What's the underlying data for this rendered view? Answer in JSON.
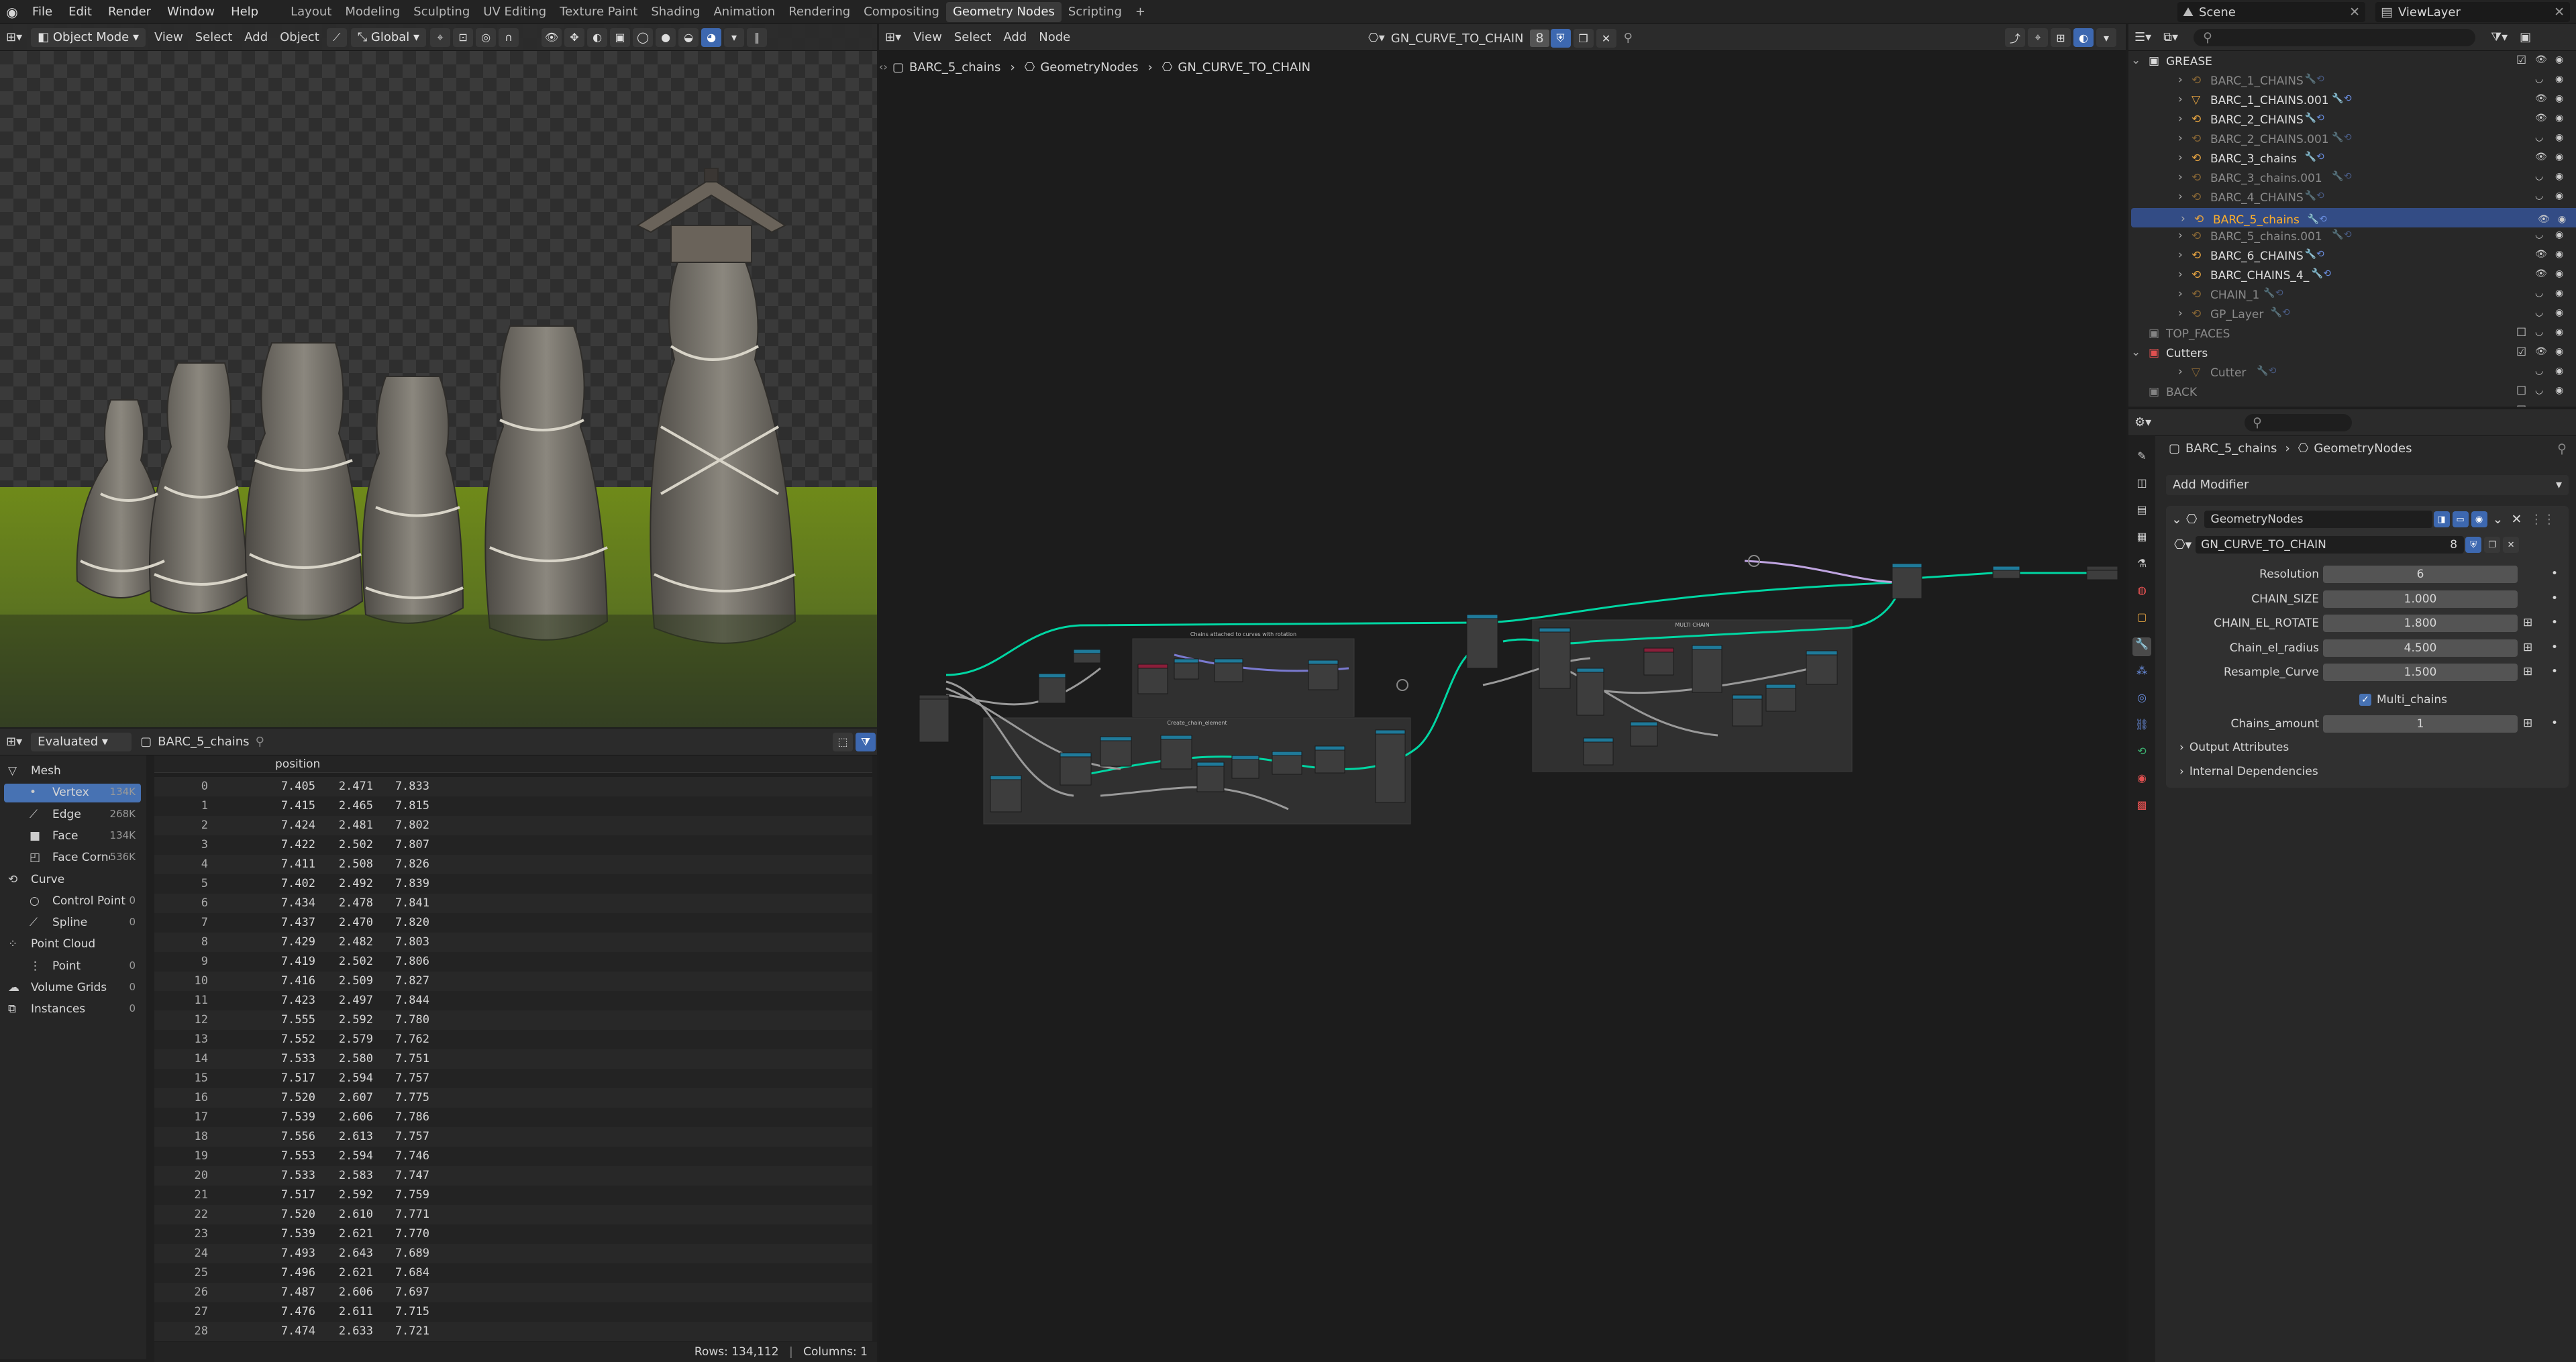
{
  "topbar": {
    "menus": [
      "File",
      "Edit",
      "Render",
      "Window",
      "Help"
    ],
    "workspaces": [
      "Layout",
      "Modeling",
      "Sculpting",
      "UV Editing",
      "Texture Paint",
      "Shading",
      "Animation",
      "Rendering",
      "Compositing",
      "Geometry Nodes",
      "Scripting"
    ],
    "active_workspace": "Geometry Nodes",
    "add_tab": "+",
    "scene": "Scene",
    "view_layer": "ViewLayer"
  },
  "viewport": {
    "mode": "Object Mode",
    "menus": [
      "View",
      "Select",
      "Add",
      "Object"
    ],
    "orientation": "Global"
  },
  "spreadsheet": {
    "display": "Evaluated",
    "object": "BARC_5_chains",
    "column_header": "position",
    "tree": [
      {
        "label": "Mesh",
        "count": "",
        "indent": 0,
        "icon": "mesh-icon"
      },
      {
        "label": "Vertex",
        "count": "134K",
        "indent": 1,
        "icon": "vertex-icon",
        "active": true
      },
      {
        "label": "Edge",
        "count": "268K",
        "indent": 1,
        "icon": "edge-icon"
      },
      {
        "label": "Face",
        "count": "134K",
        "indent": 1,
        "icon": "face-icon"
      },
      {
        "label": "Face Corner",
        "count": "536K",
        "indent": 1,
        "icon": "face-corner-icon"
      },
      {
        "label": "Curve",
        "count": "",
        "indent": 0,
        "icon": "curve-icon"
      },
      {
        "label": "Control Point",
        "count": "0",
        "indent": 1,
        "icon": "control-point-icon"
      },
      {
        "label": "Spline",
        "count": "0",
        "indent": 1,
        "icon": "spline-icon"
      },
      {
        "label": "Point Cloud",
        "count": "",
        "indent": 0,
        "icon": "point-cloud-icon"
      },
      {
        "label": "Point",
        "count": "0",
        "indent": 1,
        "icon": "point-icon"
      },
      {
        "label": "Volume Grids",
        "count": "0",
        "indent": 0,
        "icon": "volume-icon"
      },
      {
        "label": "Instances",
        "count": "0",
        "indent": 0,
        "icon": "instances-icon"
      }
    ],
    "rows": [
      [
        "0",
        "7.405",
        "2.471",
        "7.833"
      ],
      [
        "1",
        "7.415",
        "2.465",
        "7.815"
      ],
      [
        "2",
        "7.424",
        "2.481",
        "7.802"
      ],
      [
        "3",
        "7.422",
        "2.502",
        "7.807"
      ],
      [
        "4",
        "7.411",
        "2.508",
        "7.826"
      ],
      [
        "5",
        "7.402",
        "2.492",
        "7.839"
      ],
      [
        "6",
        "7.434",
        "2.478",
        "7.841"
      ],
      [
        "7",
        "7.437",
        "2.470",
        "7.820"
      ],
      [
        "8",
        "7.429",
        "2.482",
        "7.803"
      ],
      [
        "9",
        "7.419",
        "2.502",
        "7.806"
      ],
      [
        "10",
        "7.416",
        "2.509",
        "7.827"
      ],
      [
        "11",
        "7.423",
        "2.497",
        "7.844"
      ],
      [
        "12",
        "7.555",
        "2.592",
        "7.780"
      ],
      [
        "13",
        "7.552",
        "2.579",
        "7.762"
      ],
      [
        "14",
        "7.533",
        "2.580",
        "7.751"
      ],
      [
        "15",
        "7.517",
        "2.594",
        "7.757"
      ],
      [
        "16",
        "7.520",
        "2.607",
        "7.775"
      ],
      [
        "17",
        "7.539",
        "2.606",
        "7.786"
      ],
      [
        "18",
        "7.556",
        "2.613",
        "7.757"
      ],
      [
        "19",
        "7.553",
        "2.594",
        "7.746"
      ],
      [
        "20",
        "7.533",
        "2.583",
        "7.747"
      ],
      [
        "21",
        "7.517",
        "2.592",
        "7.759"
      ],
      [
        "22",
        "7.520",
        "2.610",
        "7.771"
      ],
      [
        "23",
        "7.539",
        "2.621",
        "7.770"
      ],
      [
        "24",
        "7.493",
        "2.643",
        "7.689"
      ],
      [
        "25",
        "7.496",
        "2.621",
        "7.684"
      ],
      [
        "26",
        "7.487",
        "2.606",
        "7.697"
      ],
      [
        "27",
        "7.476",
        "2.611",
        "7.715"
      ],
      [
        "28",
        "7.474",
        "2.633",
        "7.721"
      ]
    ],
    "footer_rows": "Rows: 134,112",
    "footer_sep": "|",
    "footer_cols": "Columns: 1"
  },
  "node_editor": {
    "menus": [
      "View",
      "Select",
      "Add",
      "Node"
    ],
    "tree_name": "GN_CURVE_TO_CHAIN",
    "users": "8",
    "breadcrumb": [
      "BARC_5_chains",
      "GeometryNodes",
      "GN_CURVE_TO_CHAIN"
    ],
    "frame_labels": [
      "Chains attached to curves with rotation",
      "Create_chain_element",
      "MULTI CHAIN"
    ]
  },
  "outliner": {
    "items": [
      {
        "label": "GREASE",
        "level": 0,
        "type": "collection",
        "dim": false
      },
      {
        "label": "BARC_1_CHAINS",
        "level": 1,
        "type": "gp",
        "dim": true
      },
      {
        "label": "BARC_1_CHAINS.001",
        "level": 1,
        "type": "mesh",
        "dim": false
      },
      {
        "label": "BARC_2_CHAINS",
        "level": 1,
        "type": "gp",
        "dim": false
      },
      {
        "label": "BARC_2_CHAINS.001",
        "level": 1,
        "type": "gp",
        "dim": true
      },
      {
        "label": "BARC_3_chains",
        "level": 1,
        "type": "gp",
        "dim": false
      },
      {
        "label": "BARC_3_chains.001",
        "level": 1,
        "type": "gp",
        "dim": true
      },
      {
        "label": "BARC_4_CHAINS",
        "level": 1,
        "type": "gp",
        "dim": true
      },
      {
        "label": "BARC_5_chains",
        "level": 1,
        "type": "gp",
        "dim": false,
        "selected": true
      },
      {
        "label": "BARC_5_chains.001",
        "level": 1,
        "type": "gp",
        "dim": true
      },
      {
        "label": "BARC_6_CHAINS",
        "level": 1,
        "type": "gp",
        "dim": false
      },
      {
        "label": "BARC_CHAINS_4_",
        "level": 1,
        "type": "gp",
        "dim": false
      },
      {
        "label": "CHAIN_1",
        "level": 1,
        "type": "gp",
        "dim": true
      },
      {
        "label": "GP_Layer",
        "level": 1,
        "type": "gp",
        "dim": true
      },
      {
        "label": "TOP_FACES",
        "level": 0,
        "type": "collection",
        "dim": true
      },
      {
        "label": "Cutters",
        "level": 0,
        "type": "collection-red",
        "dim": false
      },
      {
        "label": "Cutter",
        "level": 1,
        "type": "mesh",
        "dim": true
      },
      {
        "label": "BACK",
        "level": 0,
        "type": "collection",
        "dim": true
      },
      {
        "label": "TOP",
        "level": 0,
        "type": "collection",
        "dim": true
      }
    ]
  },
  "properties": {
    "breadcrumb": [
      "BARC_5_chains",
      "GeometryNodes"
    ],
    "add_modifier": "Add Modifier",
    "modifier_name": "GeometryNodes",
    "node_group": "GN_CURVE_TO_CHAIN",
    "node_group_users": "8",
    "inputs": [
      {
        "label": "Resolution",
        "value": "6"
      },
      {
        "label": "CHAIN_SIZE",
        "value": "1.000"
      },
      {
        "label": "CHAIN_EL_ROTATE",
        "value": "1.800"
      },
      {
        "label": "Chain_el_radius",
        "value": "4.500"
      },
      {
        "label": "Resample_Curve",
        "value": "1.500"
      }
    ],
    "multi_chains_label": "Multi_chains",
    "chains_amount_label": "Chains_amount",
    "chains_amount_value": "1",
    "panels": [
      "Output Attributes",
      "Internal Dependencies"
    ]
  },
  "colors": {
    "accent": "#4772b3",
    "selection": "#334c85",
    "geometry_link": "#00d6a3",
    "highlight_text": "#ffaf29"
  }
}
